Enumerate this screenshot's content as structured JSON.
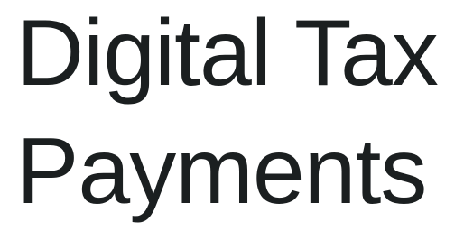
{
  "heading": {
    "line1": "Digital Tax",
    "line2": "Payments"
  }
}
